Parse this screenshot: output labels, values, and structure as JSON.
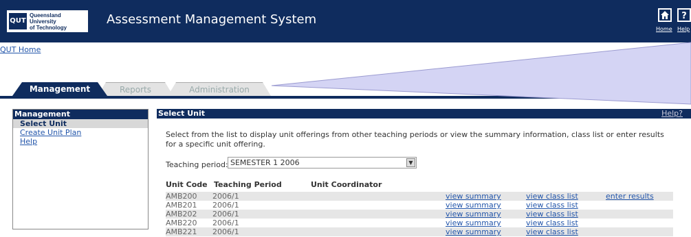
{
  "header": {
    "logo_mark": "QUT",
    "logo_name": "Queensland\nUniversity\nof Technology",
    "app_title": "Assessment Management System",
    "home_label": "Home",
    "help_label": "Help"
  },
  "breadcrumb": {
    "home_link": "QUT Home"
  },
  "tabs": [
    {
      "label": "Management",
      "active": true
    },
    {
      "label": "Reports",
      "active": false
    },
    {
      "label": "Administration",
      "active": false
    }
  ],
  "sidebar": {
    "heading": "Management",
    "items": [
      {
        "label": "Select Unit",
        "selected": true
      },
      {
        "label": "Create Unit Plan",
        "selected": false
      },
      {
        "label": "Help",
        "selected": false
      }
    ]
  },
  "main": {
    "title": "Select Unit",
    "help": "Help?",
    "intro": "Select from the list to display unit offerings from other teaching periods or view the summary information, class list or enter results for a specific unit offering.",
    "teaching_period_label": "Teaching period:",
    "teaching_period_value": "SEMESTER 1 2006",
    "columns": [
      "Unit Code",
      "Teaching Period",
      "Unit Coordinator"
    ],
    "rows": [
      {
        "code": "AMB200",
        "period": "2006/1",
        "summary": "view summary",
        "class_list": "view class list",
        "results": "enter results"
      },
      {
        "code": "AMB201",
        "period": "2006/1",
        "summary": "view summary",
        "class_list": "view class list",
        "results": ""
      },
      {
        "code": "AMB202",
        "period": "2006/1",
        "summary": "view summary",
        "class_list": "view class list",
        "results": ""
      },
      {
        "code": "AMB220",
        "period": "2006/1",
        "summary": "view summary",
        "class_list": "view class list",
        "results": ""
      },
      {
        "code": "AMB221",
        "period": "2006/1",
        "summary": "view summary",
        "class_list": "view class list",
        "results": ""
      }
    ]
  },
  "colors": {
    "navy": "#0f2c5e",
    "link": "#2255aa",
    "callout": "#d4d4f4"
  }
}
